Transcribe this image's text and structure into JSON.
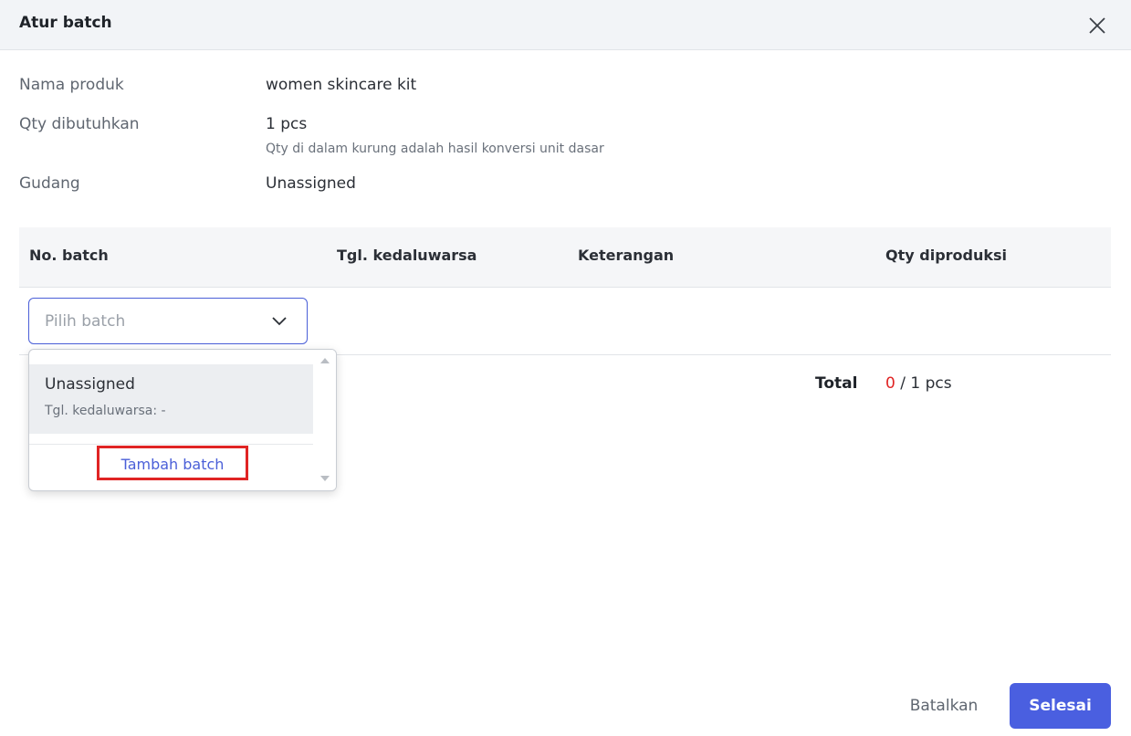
{
  "dialog": {
    "title": "Atur batch",
    "close_icon": "close-icon"
  },
  "info": {
    "product_label": "Nama produk",
    "product_value": "women skincare kit",
    "qty_label": "Qty dibutuhkan",
    "qty_value": "1 pcs",
    "qty_hint": "Qty di dalam kurung adalah hasil konversi unit dasar",
    "warehouse_label": "Gudang",
    "warehouse_value": "Unassigned"
  },
  "table": {
    "headers": [
      "No. batch",
      "Tgl. kedaluwarsa",
      "Keterangan",
      "Qty diproduksi"
    ]
  },
  "batch_select": {
    "placeholder": "Pilih batch",
    "chevron_icon": "chevron-down-icon"
  },
  "dropdown": {
    "options": [
      {
        "title": "Unassigned",
        "subtitle": "Tgl. kedaluwarsa: -"
      }
    ],
    "add_label": "Tambah batch"
  },
  "total": {
    "label": "Total",
    "current": "0",
    "required": " / 1 pcs"
  },
  "footer": {
    "cancel_label": "Batalkan",
    "done_label": "Selesai"
  },
  "colors": {
    "accent": "#4a5fe0",
    "highlight_red": "#e02424"
  }
}
